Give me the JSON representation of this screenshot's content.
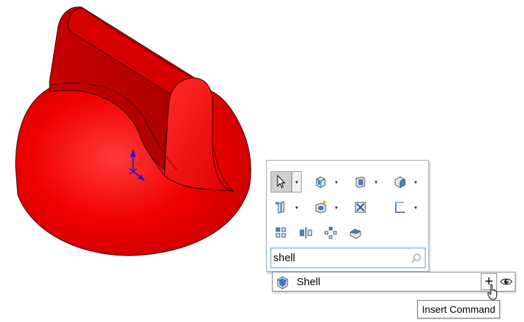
{
  "viewport": {
    "model_color": "#e80000",
    "model_dark_color": "#b00000",
    "triad_color": "#1010e0"
  },
  "shortcut_toolbar": {
    "rows": [
      [
        "select-arrow-icon",
        "extruded-boss-icon",
        "extruded-cut-icon",
        "fillet-icon"
      ],
      [
        "reference-plane-icon",
        "hole-wizard-icon",
        "rib-icon",
        "sketch-corner-icon"
      ],
      [
        "linear-pattern-icon",
        "mirror-icon",
        "circular-pattern-icon",
        "move-face-icon"
      ]
    ]
  },
  "search": {
    "value": "shell",
    "icon": "search-icon"
  },
  "results": [
    {
      "label": "Shell",
      "icon": "shell-feature-icon"
    }
  ],
  "actions": {
    "insert_symbol": "+",
    "insert_tooltip": "Insert Command",
    "preview_icon": "eye-icon"
  },
  "colors": {
    "search_border": "#5aa0d8",
    "active_tool_bg": "#cfcfcf"
  }
}
